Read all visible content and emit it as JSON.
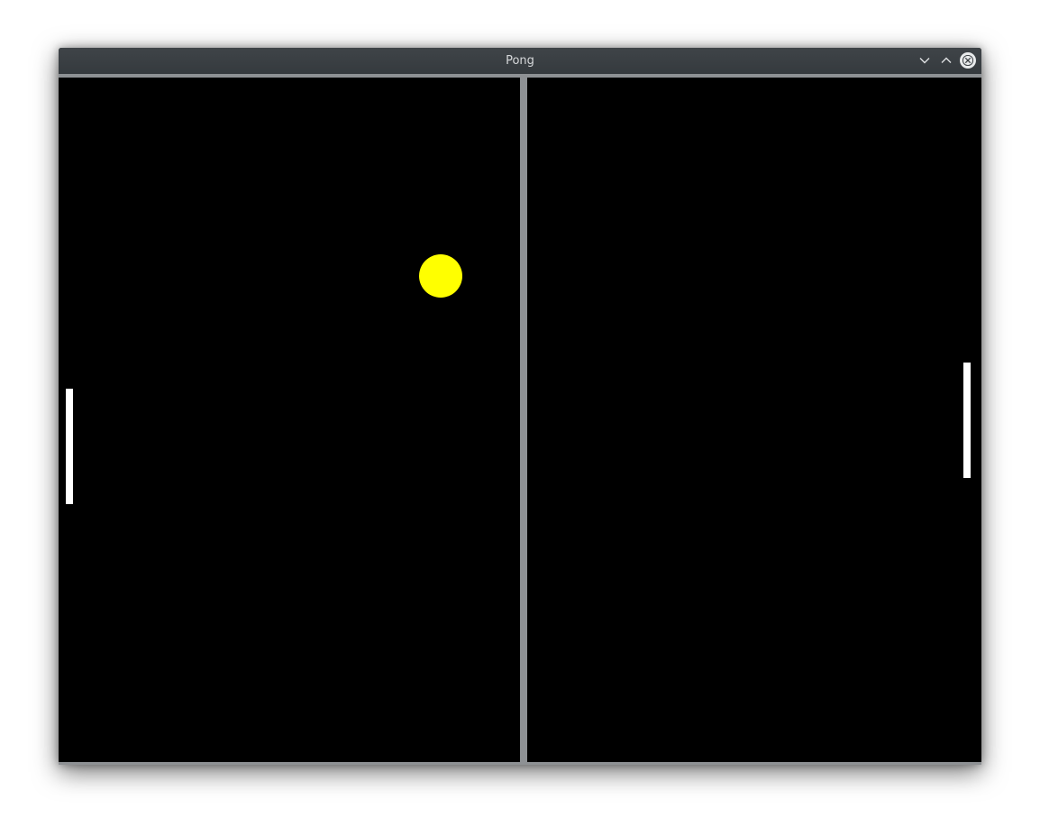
{
  "window": {
    "title": "Pong",
    "buttons": {
      "minimize_icon": "chevron-down-icon",
      "maximize_icon": "chevron-up-icon",
      "close_icon": "close-icon"
    }
  },
  "game": {
    "background_color": "#000000",
    "net_color": "#8e9194",
    "paddle_color": "#ffffff",
    "ball_color": "#ffff00"
  }
}
